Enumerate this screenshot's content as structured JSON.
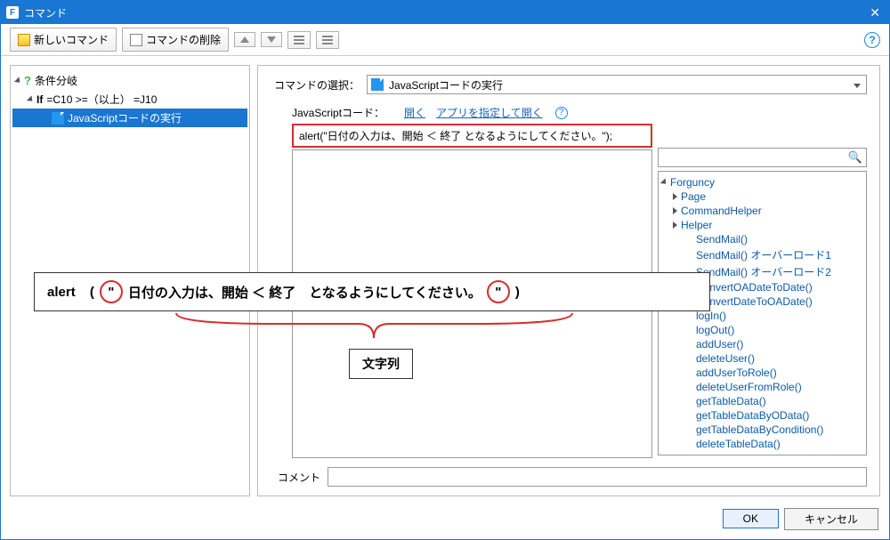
{
  "title": "コマンド",
  "toolbar": {
    "new_command": "新しいコマンド",
    "delete_command": "コマンドの削除"
  },
  "tree": {
    "root": "条件分岐",
    "if_label": "If",
    "if_expr": "=C10 >=（以上） =J10",
    "child": "JavaScriptコードの実行"
  },
  "panel": {
    "select_label": "コマンドの選択：",
    "select_value": "JavaScriptコードの実行",
    "js_label": "JavaScriptコード：",
    "link_open": "開く",
    "link_open_app": "アプリを指定して開く",
    "code_line": "alert(\"日付の入力は、開始 ＜ 終了  となるようにしてください。\");",
    "comment_label": "コメント",
    "comment_value": ""
  },
  "api": {
    "root": "Forguncy",
    "nodes": [
      "Page",
      "CommandHelper",
      "Helper"
    ],
    "funcs": [
      "SendMail()",
      "SendMail() オーバーロード1",
      "SendMail() オーバーロード2",
      "ConvertOADateToDate()",
      "ConvertDateToOADate()",
      "logIn()",
      "logOut()",
      "addUser()",
      "deleteUser()",
      "addUserToRole()",
      "deleteUserFromRole()",
      "getTableData()",
      "getTableDataByOData()",
      "getTableDataByCondition()",
      "deleteTableData()"
    ]
  },
  "annotation": {
    "alert_kw": "alert",
    "paren_open": "(",
    "quote": "\"",
    "msg": "日付の入力は、開始 ＜ 終了　となるようにしてください。",
    "paren_close": ")",
    "string_label": "文字列"
  },
  "footer": {
    "ok": "OK",
    "cancel": "キャンセル"
  }
}
